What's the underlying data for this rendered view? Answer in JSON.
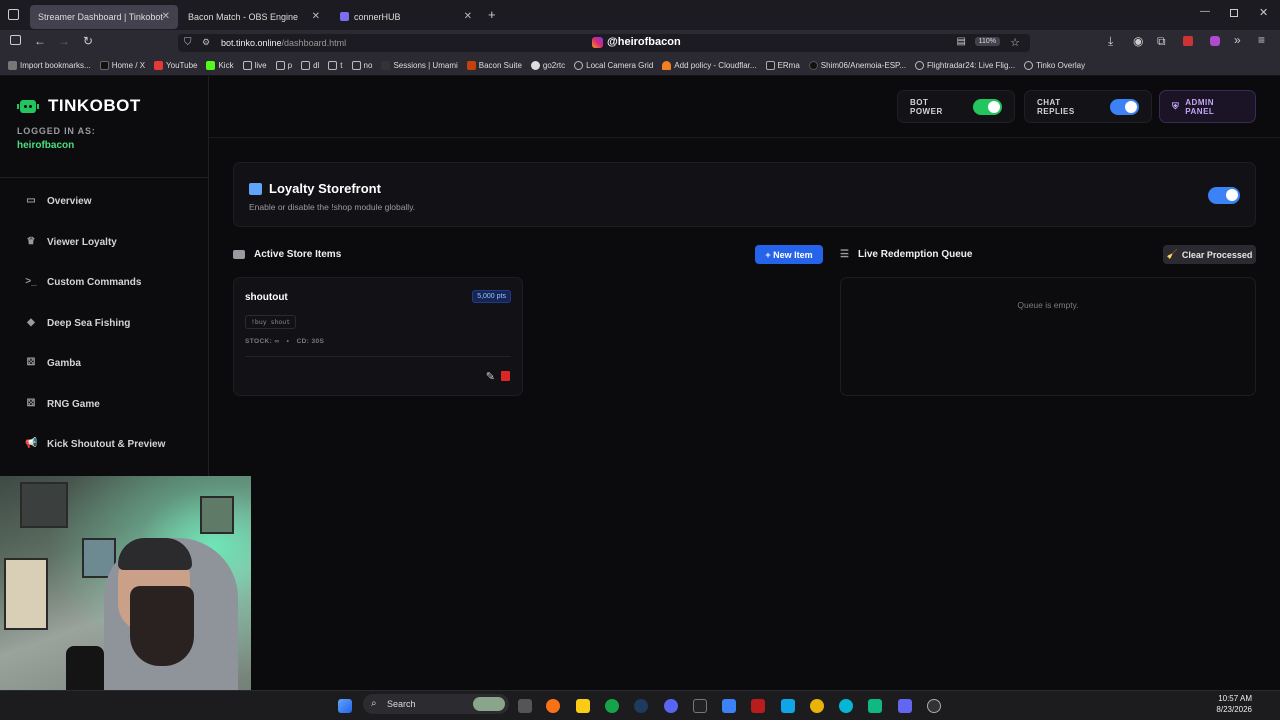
{
  "browser": {
    "tabs": [
      {
        "label": "Streamer Dashboard | Tinkobot",
        "active": true
      },
      {
        "label": "Bacon Match - OBS Engine",
        "active": false
      },
      {
        "label": "connerHUB",
        "active": false
      }
    ],
    "url_domain": "bot.tinko.online",
    "url_path": "/dashboard.html",
    "zoom": "110%",
    "overlay_handle": "@heirofbacon",
    "bookmarks": [
      "Import bookmarks...",
      "Home / X",
      "YouTube",
      "Kick",
      "live",
      "p",
      "dl",
      "t",
      "no",
      "Sessions | Umami",
      "Bacon Suite",
      "go2rtc",
      "Local Camera Grid",
      "Add policy - Cloudflar...",
      "ERma",
      "Shim06/Anemoia-ESP...",
      "Flightradar24: Live Flig...",
      "Tinko Overlay"
    ]
  },
  "app": {
    "brand": "TINKOBOT",
    "logged_in_label": "LOGGED IN AS:",
    "username": "heirofbacon",
    "nav": [
      {
        "label": "Overview",
        "icon": "monitor-icon"
      },
      {
        "label": "Viewer Loyalty",
        "icon": "crown-icon"
      },
      {
        "label": "Custom Commands",
        "icon": "terminal-icon"
      },
      {
        "label": "Deep Sea Fishing",
        "icon": "fish-icon"
      },
      {
        "label": "Gamba",
        "icon": "dice-icon"
      },
      {
        "label": "RNG Game",
        "icon": "dice-icon"
      },
      {
        "label": "Kick Shoutout & Preview",
        "icon": "megaphone-icon"
      }
    ],
    "top": {
      "bot_power": "BOT POWER",
      "chat_replies": "CHAT REPLIES",
      "admin_panel": "ADMIN PANEL",
      "bot_power_color": "#22c55e",
      "chat_replies_color": "#3b82f6"
    },
    "storefront": {
      "title": "Loyalty Storefront",
      "subtitle": "Enable or disable the !shop module globally."
    },
    "active_items": {
      "title": "Active Store Items",
      "new_item_label": "+ New Item",
      "items": [
        {
          "name": "shoutout",
          "price": "5,000 pts",
          "command": "!buy shout",
          "stock": "STOCK: ∞",
          "cooldown": "CD: 30S"
        }
      ]
    },
    "queue": {
      "title": "Live Redemption Queue",
      "clear_label": "Clear Processed",
      "empty_text": "Queue is empty."
    }
  },
  "taskbar": {
    "search_label": "Search",
    "time": "10:57 AM",
    "date": "8/23/2026"
  }
}
